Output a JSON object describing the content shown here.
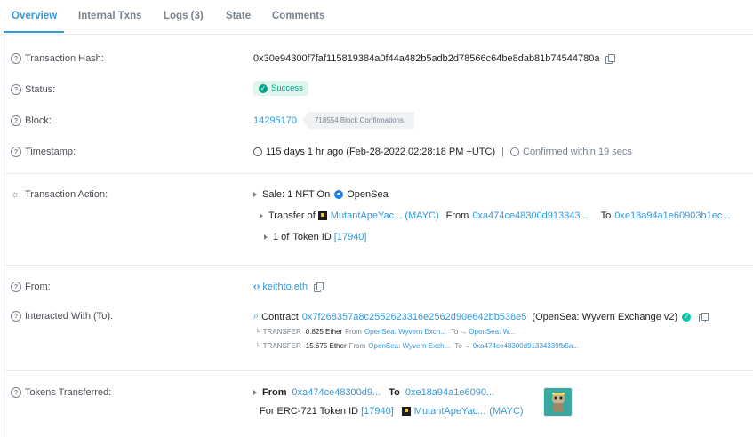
{
  "tabs": [
    "Overview",
    "Internal Txns",
    "Logs (3)",
    "State",
    "Comments"
  ],
  "labels": {
    "tx_hash": "Transaction Hash:",
    "status": "Status:",
    "block": "Block:",
    "timestamp": "Timestamp:",
    "tx_action": "Transaction Action:",
    "from": "From:",
    "interacted": "Interacted With (To):",
    "tokens": "Tokens Transferred:"
  },
  "tx_hash": "0x30e94300f7faf115819384a0f44a482b5adb2d78566c64be8dab81b74544780a",
  "status": "Success",
  "block": {
    "number": "14295170",
    "confirmations": "718554 Block Confirmations"
  },
  "timestamp": {
    "value": "115 days 1 hr ago (Feb-28-2022 02:28:18 PM +UTC)",
    "separator": "|",
    "confirmed": "Confirmed within 19 secs"
  },
  "action": {
    "sale_prefix": "Sale: 1 NFT On",
    "marketplace": "OpenSea",
    "transfer_of": "Transfer of",
    "token_name": "MutantApeYac... (MAYC)",
    "from_label": "From",
    "from_addr": "0xa474ce48300d913343...",
    "to_label": "To",
    "to_addr": "0xe18a94a1e60903b1ec...",
    "count": "1 of",
    "token_id_label": "Token ID",
    "token_id": "[17940]"
  },
  "from_value": "keithto.eth",
  "interacted": {
    "contract_label": "Contract",
    "contract_addr": "0x7f268357a8c2552623316e2562d90e642bb538e5",
    "contract_name": "(OpenSea: Wyvern Exchange v2)",
    "transfers": [
      {
        "label": "TRANSFER",
        "amount": "0.825 Ether",
        "from_label": "From",
        "from": "OpenSea: Wyvern Exch...",
        "to_label": "To",
        "to": "OpenSea: W..."
      },
      {
        "label": "TRANSFER",
        "amount": "15.675 Ether",
        "from_label": "From",
        "from": "OpenSea: Wyvern Exch...",
        "to_label": "To",
        "to": "0xa474ce48300d91334339fb5a..."
      }
    ]
  },
  "tokens": {
    "from_label": "From",
    "from_addr": "0xa474ce48300d9...",
    "to_label": "To",
    "to_addr": "0xe18a94a1e6090...",
    "for_label": "For ERC-721 Token ID",
    "token_id": "[17940]",
    "token_name": "MutantApeYac...",
    "token_symbol": "(MAYC)"
  },
  "colors": {
    "accent": "#3498db",
    "success": "#00a186",
    "success_bg": "#dff6ef"
  }
}
